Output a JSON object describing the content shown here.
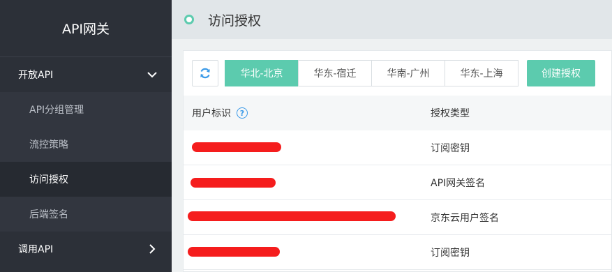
{
  "sidebar": {
    "title": "API网关",
    "groups": [
      {
        "label": "开放API",
        "expanded": true
      },
      {
        "label": "调用API",
        "expanded": false
      }
    ],
    "items": [
      {
        "label": "API分组管理"
      },
      {
        "label": "流控策略"
      },
      {
        "label": "访问授权",
        "active": true
      },
      {
        "label": "后端签名"
      }
    ]
  },
  "header": {
    "title": "访问授权"
  },
  "toolbar": {
    "refresh_icon": "refresh-icon",
    "regions": [
      "华北-北京",
      "华东-宿迁",
      "华南-广州",
      "华东-上海"
    ],
    "selected_region": "华北-北京",
    "create_label": "创建授权"
  },
  "table": {
    "columns": [
      "用户标识",
      "授权类型"
    ],
    "rows": [
      {
        "user": "",
        "auth_type": "订阅密钥"
      },
      {
        "user": "",
        "auth_type": "API网关签名"
      },
      {
        "user": "",
        "auth_type": "京东云用户签名"
      },
      {
        "user": "",
        "auth_type": "订阅密钥"
      }
    ]
  },
  "colors": {
    "accent": "#5ccbae",
    "sidebar_bg": "#2c3038",
    "redaction": "#f51d1d",
    "link": "#3b9ae8"
  }
}
